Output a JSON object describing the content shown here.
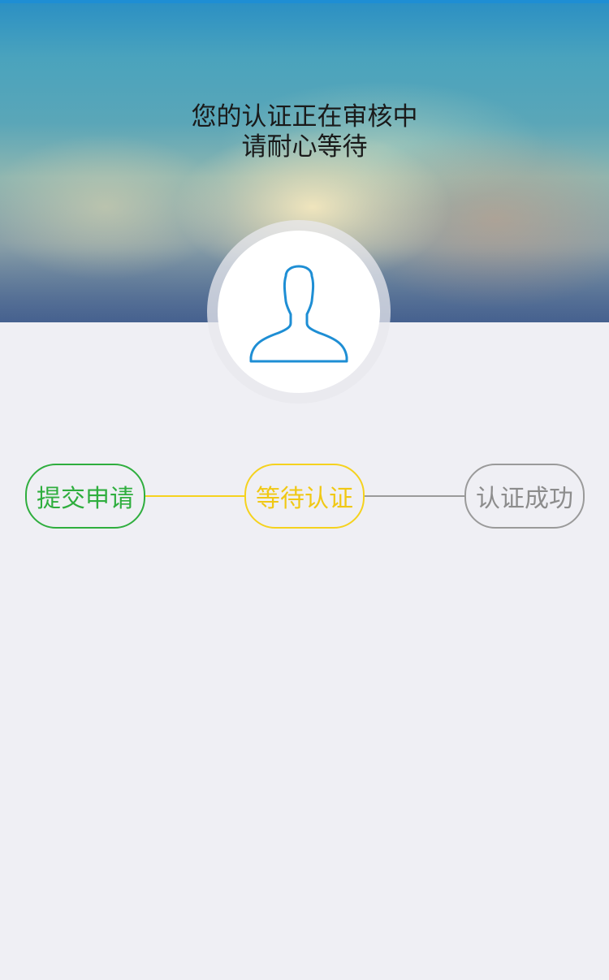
{
  "status": {
    "line1": "您的认证正在审核中",
    "line2": "请耐心等待"
  },
  "avatar": {
    "icon": "user-silhouette-icon",
    "icon_color": "#1e8ed4"
  },
  "steps": [
    {
      "label": "提交申请",
      "state": "done",
      "color": "#2fae3e"
    },
    {
      "label": "等待认证",
      "state": "current",
      "color": "#f5d21e"
    },
    {
      "label": "认证成功",
      "state": "pending",
      "color": "#9a9a9a"
    }
  ]
}
